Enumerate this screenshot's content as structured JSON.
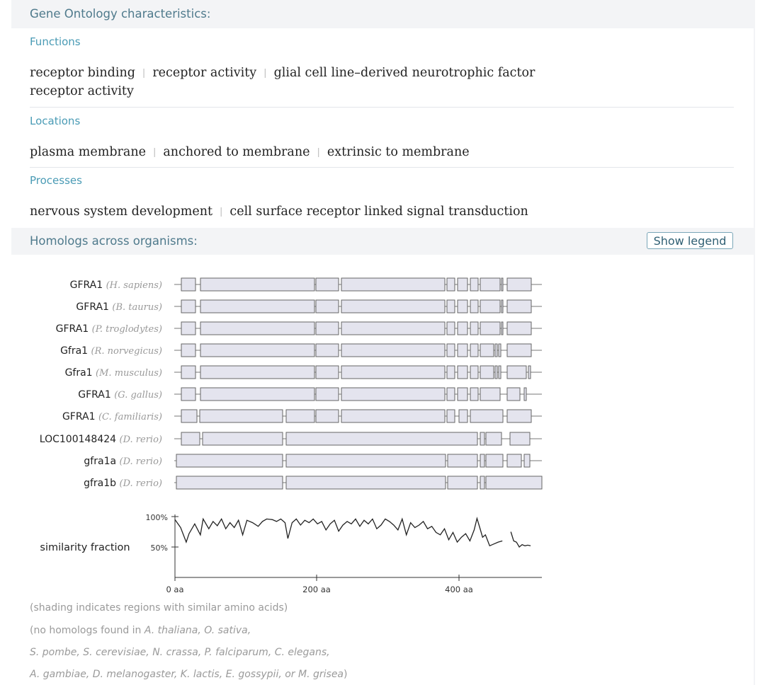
{
  "go": {
    "title": "Gene Ontology characteristics:",
    "functions": {
      "label": "Functions",
      "terms": [
        "receptor binding",
        "receptor activity",
        "glial cell line–derived neurotrophic factor"
      ],
      "terms_wrap": "receptor activity"
    },
    "locations": {
      "label": "Locations",
      "terms": [
        "plasma membrane",
        "anchored to membrane",
        "extrinsic to membrane"
      ]
    },
    "processes": {
      "label": "Processes",
      "terms": [
        "nervous system development",
        "cell surface receptor linked signal transduction"
      ]
    }
  },
  "homologs": {
    "title": "Homologs across organisms:",
    "show_legend": "Show legend",
    "rows": [
      {
        "gene": "GFRA1",
        "organism": "(H. sapiens)"
      },
      {
        "gene": "GFRA1",
        "organism": "(B. taurus)"
      },
      {
        "gene": "GFRA1",
        "organism": "(P. troglodytes)"
      },
      {
        "gene": "Gfra1",
        "organism": "(R. norvegicus)"
      },
      {
        "gene": "Gfra1",
        "organism": "(M. musculus)"
      },
      {
        "gene": "GFRA1",
        "organism": "(G. gallus)"
      },
      {
        "gene": "GFRA1",
        "organism": "(C. familiaris)"
      },
      {
        "gene": "LOC100148424",
        "organism": "(D. rerio)"
      },
      {
        "gene": "gfra1a",
        "organism": "(D. rerio)"
      },
      {
        "gene": "gfra1b",
        "organism": "(D. rerio)"
      }
    ],
    "similarity_label": "similarity fraction",
    "y_ticks": [
      "100%",
      "50%"
    ],
    "x_ticks": [
      "0 aa",
      "200 aa",
      "400 aa"
    ],
    "notes": {
      "shading": "(shading indicates regions with similar amino acids)",
      "line1_prefix": "(no homologs found in ",
      "line1_species": "A. thaliana, O. sativa,",
      "line2": "S. pombe, S. cerevisiae, N. crassa, P. falciparum, C. elegans,",
      "line3_species": "A. gambiae, D. melanogaster, K. lactis, E. gossypii, or M. grisea",
      "line3_suffix": ")"
    }
  },
  "chart_data": {
    "type": "line",
    "title": "",
    "xlabel": "",
    "ylabel": "similarity fraction",
    "xlim": [
      0,
      520
    ],
    "ylim": [
      0,
      1
    ],
    "x": [
      0,
      8,
      16,
      20,
      28,
      36,
      40,
      48,
      54,
      60,
      66,
      72,
      78,
      84,
      90,
      96,
      102,
      110,
      118,
      124,
      130,
      138,
      144,
      150,
      156,
      160,
      166,
      172,
      178,
      184,
      190,
      196,
      202,
      208,
      214,
      220,
      226,
      232,
      238,
      244,
      250,
      256,
      262,
      268,
      274,
      280,
      286,
      292,
      298,
      304,
      310,
      316,
      322,
      328,
      334,
      340,
      346,
      352,
      358,
      364,
      370,
      376,
      382,
      388,
      394,
      400,
      406,
      412,
      418,
      424,
      428,
      432,
      436,
      440,
      446,
      452,
      458,
      464,
      470,
      476,
      480,
      484,
      488,
      492,
      496,
      500,
      504
    ],
    "y": [
      0.95,
      0.82,
      0.58,
      0.72,
      0.88,
      0.7,
      0.96,
      0.8,
      0.92,
      0.85,
      0.96,
      0.8,
      0.9,
      0.82,
      0.94,
      0.7,
      0.94,
      0.9,
      0.84,
      0.92,
      0.96,
      0.95,
      0.92,
      0.96,
      0.9,
      0.64,
      0.9,
      0.96,
      0.86,
      0.94,
      0.9,
      0.96,
      0.88,
      0.92,
      0.78,
      0.88,
      0.94,
      0.76,
      0.86,
      0.92,
      0.88,
      0.96,
      0.84,
      0.94,
      0.88,
      0.96,
      0.8,
      0.86,
      0.96,
      0.92,
      0.86,
      0.78,
      0.96,
      0.7,
      0.9,
      0.82,
      0.86,
      0.92,
      0.8,
      0.84,
      0.74,
      0.7,
      0.8,
      0.62,
      0.74,
      0.58,
      0.66,
      0.72,
      0.6,
      0.78,
      0.97,
      0.82,
      0.66,
      0.7,
      0.52,
      0.55,
      0.58,
      0.6,
      null,
      0.75,
      0.6,
      0.58,
      0.5,
      0.54,
      0.52,
      0.53,
      0.52
    ]
  }
}
